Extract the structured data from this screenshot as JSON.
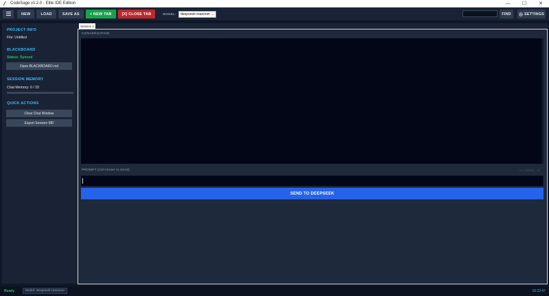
{
  "window": {
    "title": "CodeSage v1.2.0 - Elite IDE Edition",
    "controls": {
      "minimize": "—",
      "maximize": "☐",
      "close": "✕"
    }
  },
  "toolbar": {
    "menu_icon": "menu-icon",
    "new_label": "NEW",
    "load_label": "LOAD",
    "save_as_label": "SAVE AS",
    "new_tab_label": "+ NEW TAB",
    "close_tab_label": "[X] CLOSE TAB",
    "model_label": "MODEL:",
    "model_value": "deepseek-reasoner",
    "find_value": "",
    "find_label": "FIND",
    "settings_label": "SETTINGS"
  },
  "sidebar": {
    "project_heading": "PROJECT INFO",
    "file_text": "File: Untitled",
    "blackboard_heading": "BLACKBOARD",
    "blackboard_status": "Status: Synced",
    "open_blackboard_label": "Open BLACKBOARD.md",
    "memory_heading": "SESSION MEMORY",
    "memory_text": "Chat Memory: 0 / 20",
    "memory_fraction": 0,
    "quick_actions_heading": "QUICK ACTIONS",
    "clear_chat_label": "Clear Chat Window",
    "export_session_label": "Export Session MD"
  },
  "main": {
    "tabs": [
      {
        "label": "Session 1"
      }
    ],
    "conversation_label": "CONVERSATION",
    "prompt_label": "PROMPT (Ctrl+Enter to Send)",
    "token_hint": "0 A  Tokens: ~0",
    "prompt_value": "",
    "send_label": "SEND TO DEEPSEEK"
  },
  "statusbar": {
    "status": "Ready",
    "model": "Model: deepseek-reasoner",
    "time": "16:22:47"
  },
  "colors": {
    "accent_heading": "#38bdf8",
    "success": "#22c55e",
    "primary_button": "#2563eb",
    "new_tab_button": "#16a34a",
    "close_tab_button": "#c0262d"
  }
}
